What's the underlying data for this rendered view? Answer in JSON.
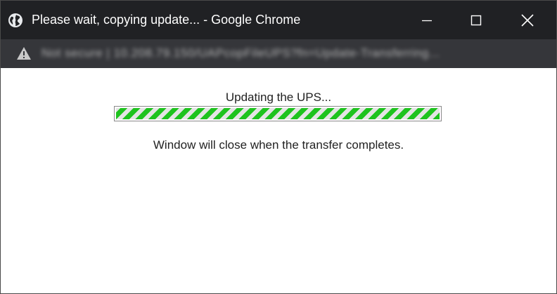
{
  "window": {
    "title": "Please wait, copying update... - Google Chrome",
    "icon": "globe-icon",
    "controls": {
      "minimize_icon": "minimize-icon",
      "maximize_icon": "maximize-icon",
      "close_icon": "close-icon"
    }
  },
  "addressbar": {
    "warning_icon": "warning-icon",
    "url_text": "Not secure | 10.208.79.150/UAPcopFileUPS?fn=Update-Transferring..."
  },
  "content": {
    "status_text": "Updating the UPS...",
    "progress": {
      "value": 1.0,
      "style": "striped-animated",
      "fill_color": "#1ec31e",
      "stripe_color": "#e4e4e4"
    },
    "note_text": "Window will close when the transfer completes."
  },
  "colors": {
    "titlebar_bg": "#202124",
    "addressbar_bg": "#35363a"
  }
}
